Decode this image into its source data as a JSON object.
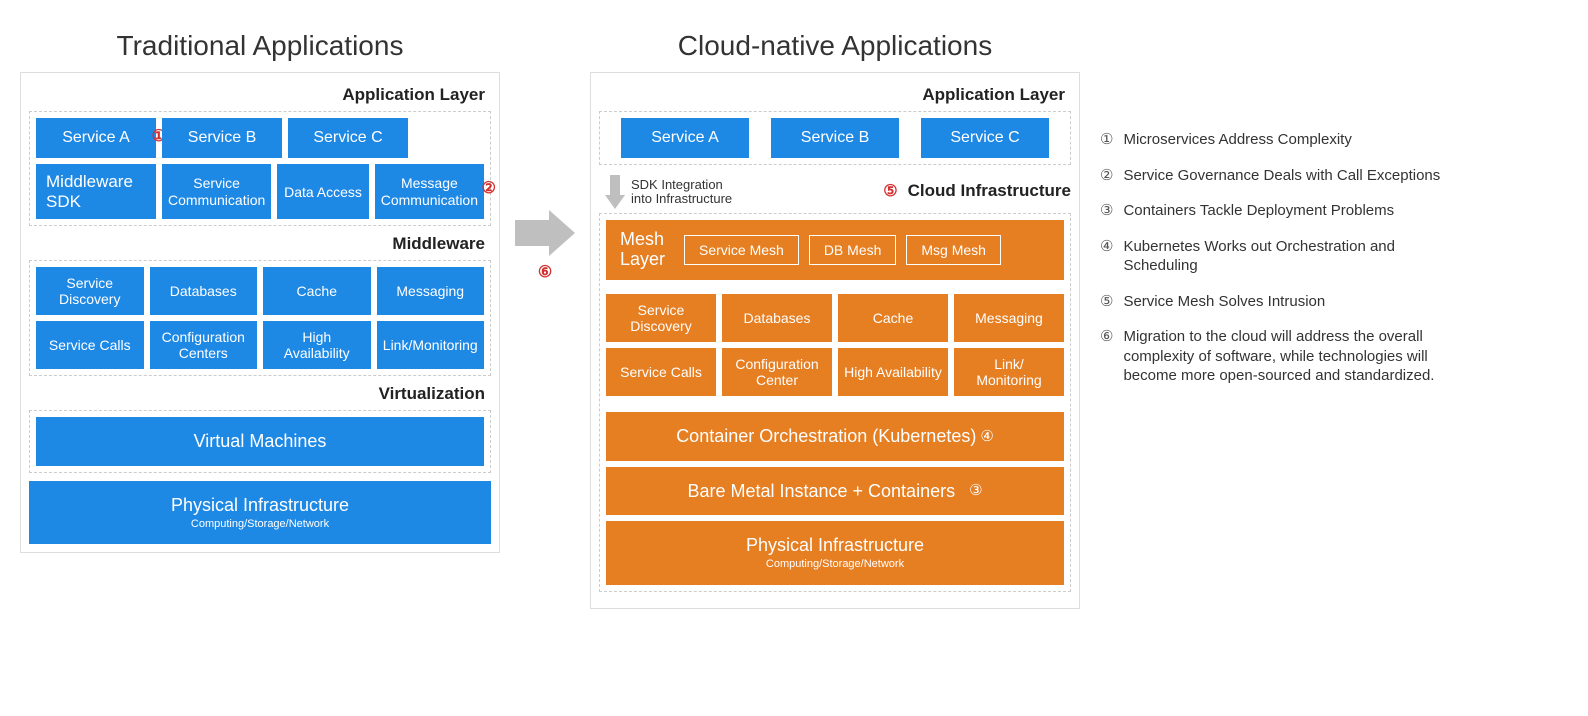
{
  "traditional": {
    "title": "Traditional Applications",
    "app_layer_label": "Application Layer",
    "services": [
      "Service A",
      "Service B",
      "Service C"
    ],
    "middleware_sdk": "Middleware SDK",
    "sdk_items": [
      "Service Communication",
      "Data Access",
      "Message Communication"
    ],
    "middleware_label": "Middleware",
    "middleware_row1": [
      "Service Discovery",
      "Databases",
      "Cache",
      "Messaging"
    ],
    "middleware_row2": [
      "Service Calls",
      "Configuration Centers",
      "High Availability",
      "Link/Monitoring"
    ],
    "virtualization_label": "Virtualization",
    "vm": "Virtual Machines",
    "physical": "Physical Infrastructure",
    "physical_sub": "Computing/Storage/Network"
  },
  "cloud": {
    "title": "Cloud-native Applications",
    "app_layer_label": "Application Layer",
    "services": [
      "Service A",
      "Service B",
      "Service C"
    ],
    "sdk_note": "SDK Integration into Infrastructure",
    "cloud_infra_label": "Cloud Infrastructure",
    "mesh_layer": "Mesh Layer",
    "mesh_items": [
      "Service Mesh",
      "DB Mesh",
      "Msg Mesh"
    ],
    "infra_row1": [
      "Service Discovery",
      "Databases",
      "Cache",
      "Messaging"
    ],
    "infra_row2": [
      "Service Calls",
      "Configuration Center",
      "High Availability",
      "Link/ Monitoring"
    ],
    "orchestration": "Container Orchestration (Kubernetes)",
    "bare_metal": "Bare Metal Instance + Containers",
    "physical": "Physical Infrastructure",
    "physical_sub": "Computing/Storage/Network"
  },
  "legend": [
    "Microservices Address Complexity",
    "Service Governance Deals with Call Exceptions",
    "Containers Tackle Deployment Problems",
    "Kubernetes Works out Orchestration and Scheduling",
    "Service Mesh Solves Intrusion",
    "Migration to the cloud will address the overall complexity of software, while technologies will become more open-sourced and standardized."
  ],
  "markers": {
    "m1": "①",
    "m2": "②",
    "m3": "③",
    "m4": "④",
    "m5": "⑤",
    "m6": "⑥"
  }
}
